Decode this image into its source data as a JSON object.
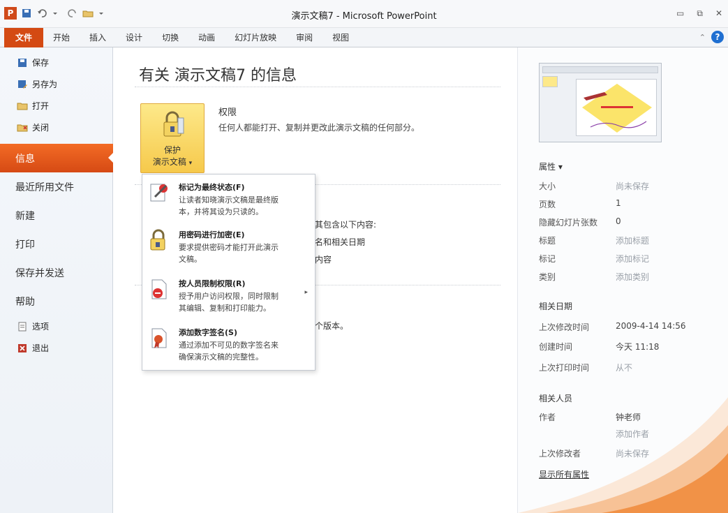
{
  "titlebar": {
    "app_icon": "P",
    "title": "演示文稿7 - Microsoft PowerPoint"
  },
  "ribbon": {
    "tabs": [
      "文件",
      "开始",
      "插入",
      "设计",
      "切换",
      "动画",
      "幻灯片放映",
      "审阅",
      "视图"
    ],
    "help_icon": "?"
  },
  "nav": {
    "small_top": [
      "保存",
      "另存为",
      "打开",
      "关闭"
    ],
    "big": [
      "信息",
      "最近所用文件",
      "新建",
      "打印",
      "保存并发送",
      "帮助"
    ],
    "small_bottom": [
      "选项",
      "退出"
    ]
  },
  "main": {
    "title": "有关 演示文稿7 的信息",
    "protect_label_1": "保护",
    "protect_label_2": "演示文稿",
    "protect_caret": "▾",
    "permissions_title": "权限",
    "permissions_desc": "任何人都能打开、复制并更改此演示文稿的任何部分。",
    "fragments": [
      "意其包含以下内容:",
      "姓名和相关日期",
      "的内容",
      "一个版本。"
    ]
  },
  "menu": {
    "items": [
      {
        "title": "标记为最终状态(F)",
        "desc_1": "让读者知晓演示文稿是最终版",
        "desc_2": "本，并将其设为只读的。"
      },
      {
        "title": "用密码进行加密(E)",
        "desc_1": "要求提供密码才能打开此演示",
        "desc_2": "文稿。"
      },
      {
        "title": "按人员限制权限(R)",
        "desc_1": "授予用户访问权限，同时限制",
        "desc_2": "其编辑、复制和打印能力。"
      },
      {
        "title": "添加数字签名(S)",
        "desc_1": "通过添加不可见的数字签名来",
        "desc_2": "确保演示文稿的完整性。"
      }
    ]
  },
  "properties": {
    "header": "属性 ▾",
    "rows": [
      {
        "key": "大小",
        "value": "尚未保存"
      },
      {
        "key": "页数",
        "value": "1"
      },
      {
        "key": "隐藏幻灯片张数",
        "value": "0"
      },
      {
        "key": "标题",
        "value": "添加标题"
      },
      {
        "key": "标记",
        "value": "添加标记"
      },
      {
        "key": "类别",
        "value": "添加类别"
      }
    ],
    "dates_header": "相关日期",
    "dates": [
      {
        "key": "上次修改时间",
        "value": "2009-4-14 14:56"
      },
      {
        "key": "创建时间",
        "value": "今天 11:18"
      },
      {
        "key": "上次打印时间",
        "value": "从不"
      }
    ],
    "people_header": "相关人员",
    "author_key": "作者",
    "author_value": "钟老师",
    "add_author": "添加作者",
    "last_modified_by_key": "上次修改者",
    "last_modified_by_value": "尚未保存",
    "show_all": "显示所有属性"
  },
  "colors": {
    "accent": "#d44a13",
    "highlight": "#f6c94b"
  }
}
